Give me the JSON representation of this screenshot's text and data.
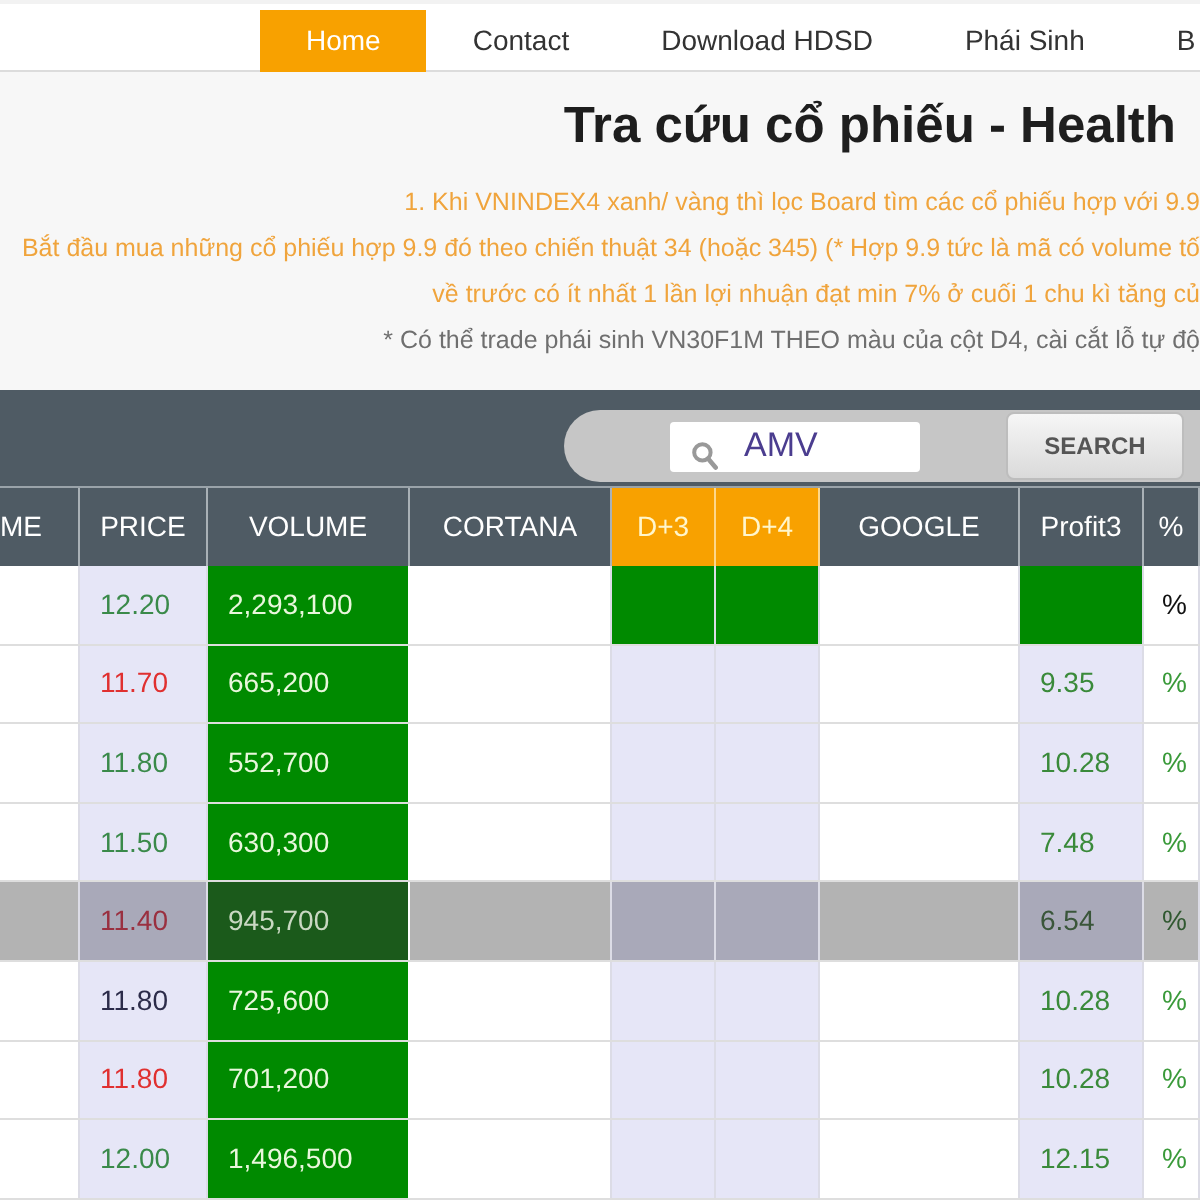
{
  "nav": [
    {
      "label": "Home",
      "selected": true
    },
    {
      "label": "Contact",
      "selected": false
    },
    {
      "label": "Download HDSD",
      "selected": false
    },
    {
      "label": "Phái Sinh",
      "selected": false
    },
    {
      "label": "B",
      "selected": false
    }
  ],
  "title": "Tra cứu cổ phiếu - Health",
  "notes": [
    {
      "kind": "highlight",
      "text": "1. Khi VNINDEX4 xanh/ vàng thì lọc Board tìm các cổ phiếu hợp với 9.9"
    },
    {
      "kind": "highlight",
      "text": "Bắt đầu mua những cổ phiếu hợp 9.9 đó theo chiến thuật 34 (hoặc 345) (* Hợp 9.9 tức là mã có volume tố"
    },
    {
      "kind": "highlight",
      "text": "về trước có ít nhất 1 lần lợi nhuận đạt min 7% ở cuối 1 chu kì tăng củ"
    },
    {
      "kind": "note",
      "text": "* Có thể trade phái sinh VN30F1M THEO màu của cột D4, cài cắt lỗ tự độ"
    }
  ],
  "search": {
    "value": "AMV",
    "button": "SEARCH"
  },
  "table": {
    "columns": [
      {
        "label": "ME",
        "kind": "plain"
      },
      {
        "label": "PRICE",
        "kind": "plain"
      },
      {
        "label": "VOLUME",
        "kind": "plain"
      },
      {
        "label": "CORTANA",
        "kind": "plain"
      },
      {
        "label": "D+3",
        "kind": "signal"
      },
      {
        "label": "D+4",
        "kind": "signal"
      },
      {
        "label": "GOOGLE",
        "kind": "plain"
      },
      {
        "label": "Profit3",
        "kind": "plain"
      },
      {
        "label": "%",
        "kind": "plain"
      }
    ],
    "rows": [
      {
        "price": "12.20",
        "price_up": true,
        "price_down": false,
        "volume": "2,293,100",
        "d3_signal": true,
        "d4_signal": true,
        "profit3_signal": true,
        "pct": "%",
        "selected": false
      },
      {
        "price": "11.70",
        "price_up": false,
        "price_down": true,
        "volume": "665,200",
        "d3_signal": false,
        "d4_signal": false,
        "profit3_signal": false,
        "profit3": "9.35",
        "pct": "%",
        "selected": false
      },
      {
        "price": "11.80",
        "price_up": true,
        "price_down": false,
        "volume": "552,700",
        "d3_signal": false,
        "d4_signal": false,
        "profit3_signal": false,
        "profit3": "10.28",
        "pct": "%",
        "selected": false
      },
      {
        "price": "11.50",
        "price_up": true,
        "price_down": false,
        "volume": "630,300",
        "d3_signal": false,
        "d4_signal": false,
        "profit3_signal": false,
        "profit3": "7.48",
        "pct": "%",
        "selected": false
      },
      {
        "price": "11.40",
        "price_up": false,
        "price_down": true,
        "volume": "945,700",
        "d3_signal": false,
        "d4_signal": false,
        "profit3_signal": false,
        "profit3": "6.54",
        "pct": "%",
        "selected": true
      },
      {
        "price": "11.80",
        "price_up": false,
        "price_down": false,
        "volume": "725,600",
        "d3_signal": false,
        "d4_signal": false,
        "profit3_signal": false,
        "profit3": "10.28",
        "pct": "%",
        "selected": false
      },
      {
        "price": "11.80",
        "price_up": false,
        "price_down": true,
        "volume": "701,200",
        "d3_signal": false,
        "d4_signal": false,
        "profit3_signal": false,
        "profit3": "10.28",
        "pct": "%",
        "selected": false
      },
      {
        "price": "12.00",
        "price_up": true,
        "price_down": false,
        "volume": "1,496,500",
        "d3_signal": false,
        "d4_signal": false,
        "profit3_signal": false,
        "profit3": "12.15",
        "pct": "%",
        "selected": false
      }
    ]
  }
}
